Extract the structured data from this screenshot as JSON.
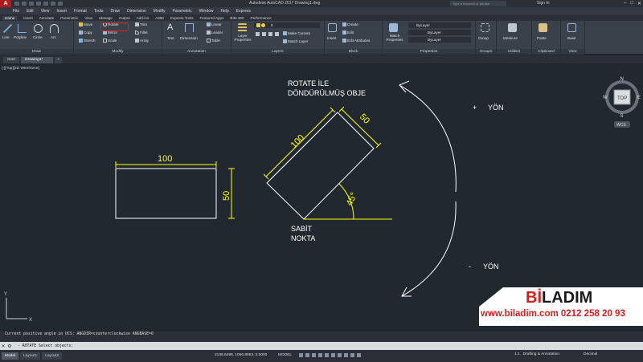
{
  "window": {
    "logo": "A",
    "title": "Autodesk AutoCAD 2017   Drawing1.dwg",
    "search_placeholder": "Type a keyword or phrase",
    "sign_in": "Sign In",
    "controls": [
      "–",
      "□",
      "✕"
    ]
  },
  "menu": [
    "File",
    "Edit",
    "View",
    "Insert",
    "Format",
    "Tools",
    "Draw",
    "Dimension",
    "Modify",
    "Parametric",
    "Window",
    "Help",
    "Express"
  ],
  "ribbon_tabs": [
    "Home",
    "Insert",
    "Annotate",
    "Parametric",
    "View",
    "Manage",
    "Output",
    "Add-ins",
    "A360",
    "Express Tools",
    "Featured Apps",
    "BIM 360",
    "Performance"
  ],
  "ribbon": {
    "draw": {
      "label": "Draw",
      "line": "Line",
      "polyline": "Polyline",
      "circle": "Circle",
      "arc": "Arc"
    },
    "modify": {
      "label": "Modify",
      "move": "Move",
      "rotate": "Rotate",
      "trim": "Trim",
      "copy": "Copy",
      "mirror": "Mirror",
      "fillet": "Fillet",
      "stretch": "Stretch",
      "scale": "Scale",
      "array": "Array"
    },
    "annotation": {
      "label": "Annotation",
      "text": "Text",
      "dimension": "Dimension",
      "linear": "Linear",
      "leader": "Leader",
      "table": "Table"
    },
    "layers": {
      "label": "Layers",
      "layer_properties": "Layer Properties",
      "layer_value": "0",
      "make_current": "Make Current",
      "match_layer": "Match Layer"
    },
    "block": {
      "label": "Block",
      "insert": "Insert",
      "create": "Create",
      "edit": "Edit",
      "edit_attributes": "Edit Attributes"
    },
    "properties": {
      "label": "Properties",
      "match_properties": "Match Properties",
      "bylayer_1": "ByLayer",
      "bylayer_2": "ByLayer",
      "bylayer_3": "ByLayer"
    },
    "groups": {
      "label": "Groups",
      "group": "Group"
    },
    "utilities": {
      "label": "Utilities",
      "measure": "Measure"
    },
    "clipboard": {
      "label": "Clipboard",
      "paste": "Paste"
    },
    "view": {
      "label": "View",
      "base": "Base"
    }
  },
  "doc_tabs": [
    "Start",
    "Drawing1*",
    "+"
  ],
  "viewport_label": "[-][Top][2D Wireframe]",
  "viewcube": {
    "n": "N",
    "s": "S",
    "w": "W",
    "e": "E",
    "face": "TOP",
    "ucs": "WCS"
  },
  "drawing": {
    "rect_width_dim": "100",
    "rect_height_dim": "50",
    "rotated_width_dim": "100",
    "rotated_height_dim": "50",
    "angle_dim": "45°",
    "title_line1": "ROTATE İLE",
    "title_line2": "DÖNDÜRÜLMÜŞ OBJE",
    "base_line1": "SABİT",
    "base_line2": "NOKTA",
    "plus_sign": "+",
    "plus_dir": "YÖN",
    "minus_sign": "-",
    "minus_dir": "YÖN",
    "ucs_x": "X",
    "ucs_y": "Y"
  },
  "watermark": {
    "brand_bi": "Bİ",
    "brand_rest": "LADIM",
    "contact": "www.biladim.com 0212 258 20 93"
  },
  "command": {
    "history": "Current positive angle in UCS:  ANGDIR=counterclockwise  ANGBASE=0",
    "prompt": "- ROTATE Select objects:"
  },
  "status": {
    "layouts": [
      "Model",
      "Layout1",
      "Layout2"
    ],
    "coordinates": "2138.6498, 1066.8953, 0.0000",
    "model": "MODEL",
    "scale": "1:1",
    "workspace": "Drafting & Annotation",
    "units": "Decimal"
  },
  "colors": {
    "canvas": "#212830",
    "geometry": "#ffffff",
    "dimension": "#ffff00",
    "brand_red": "#d41e1e"
  }
}
